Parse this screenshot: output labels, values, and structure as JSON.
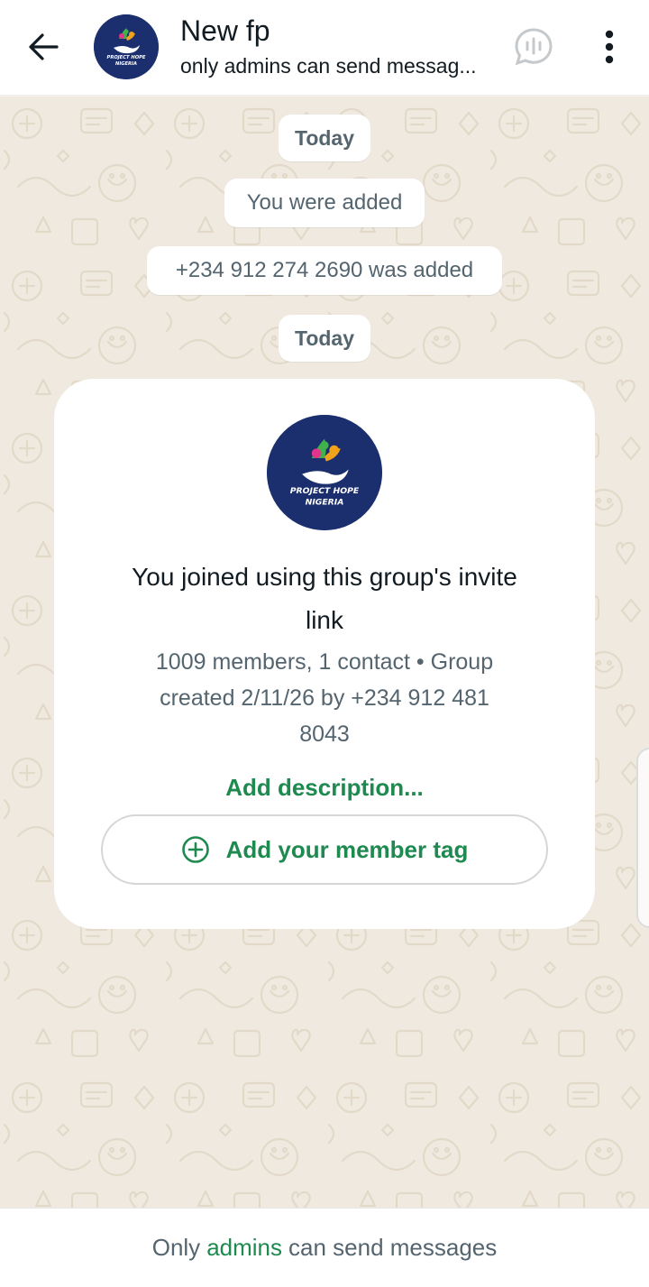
{
  "header": {
    "title": "New fp",
    "subtitle": "only admins can send messag...",
    "logo_text_line1": "PROJECT HOPE",
    "logo_text_line2": "NIGERIA"
  },
  "chat": {
    "date_chip_1": "Today",
    "system_1": "You were added",
    "system_2": "+234 912 274 2690 was added",
    "date_chip_2": "Today",
    "card": {
      "logo_text_line1": "PROJECT HOPE",
      "logo_text_line2": "NIGERIA",
      "title_line1": "You joined using this group's invite",
      "title_line2": "link",
      "meta_line1": "1009 members, 1 contact • Group",
      "meta_line2": "created 2/11/26 by +234 912 481",
      "meta_line3": "8043",
      "add_description": "Add description...",
      "member_tag_button": "Add your member tag"
    }
  },
  "footer": {
    "prefix": "Only",
    "link": "admins",
    "suffix": "can send messages"
  },
  "colors": {
    "accent_green": "#1f8a50",
    "logo_navy": "#1b2f6e",
    "wallpaper": "#efe9df"
  },
  "icons": {
    "back": "arrow-left-icon",
    "voice_chat": "voice-chat-icon",
    "more": "more-vertical-icon",
    "add": "plus-circle-icon"
  }
}
